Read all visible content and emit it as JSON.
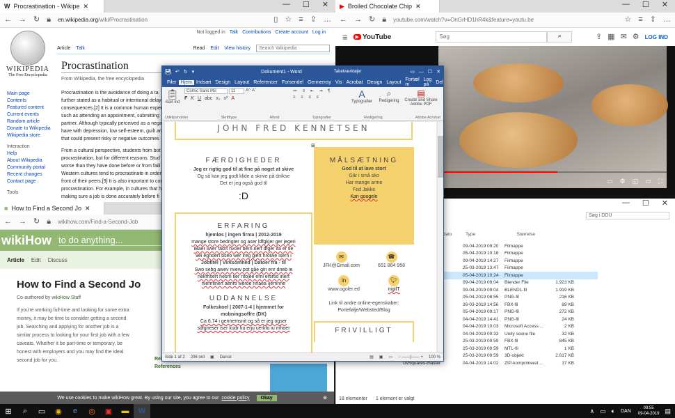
{
  "wiki": {
    "tab": "Procrastination - Wikipe",
    "url_host": "en.wikipedia.org",
    "url_path": "/wiki/Procrastination",
    "not_logged": "Not logged in",
    "talk": "Talk",
    "contributions": "Contributions",
    "create_account": "Create account",
    "login": "Log in",
    "logo_title": "WIKIPEDIA",
    "logo_sub": "The Free Encyclopedia",
    "tabs": [
      "Article",
      "Talk"
    ],
    "actions": [
      "Read",
      "Edit",
      "View history"
    ],
    "search_ph": "Search Wikipedia",
    "title": "Procrastination",
    "from": "From Wikipedia, the free encyclopedia",
    "sidebar": [
      "Main page",
      "Contents",
      "Featured content",
      "Current events",
      "Random article",
      "Donate to Wikipedia",
      "Wikipedia store"
    ],
    "interaction_head": "Interaction",
    "interaction": [
      "Help",
      "About Wikipedia",
      "Community portal",
      "Recent changes",
      "Contact page"
    ],
    "tools_head": "Tools",
    "body1": [
      "Procrastination is the avoidance of doing a ta",
      "further stated as a habitual or intentional delay",
      "consequences.[2] It is a common human exper",
      "such as attending an appointment, submitting",
      "partner. Although typically perceived as a nega",
      "have with depression, low self-esteem, guilt and ina",
      "that could present risky or negative outcomes"
    ],
    "body2": [
      "From a cultural perspective, students from bot",
      "procrastination, but for different reasons. Stud",
      "worse than they have done before or from faili",
      "Western cultures tend to procrastinate in order",
      "front of their peers.[9] It is also important to con",
      "procrastination. For example, in cultures that h",
      "making sure a job is done accurately before fi"
    ]
  },
  "youtube": {
    "tab": "Broiled Chocolate Chip",
    "url": "youtube.com/watch?v=OnGrHD1hR4k&feature=youtu.be",
    "logo": "YouTube",
    "search": "Søg",
    "login": "LOG IND"
  },
  "wikihow": {
    "tab": "How to Find a Second Jo",
    "url": "wikihow.com/Find-a-Second-Job",
    "logo": "wikiHow",
    "search_ph": "to do anything...",
    "nav": [
      "Article",
      "Edit",
      "Discuss"
    ],
    "title": "How to Find a Second Jo",
    "coauthor": "Co-authored by",
    "staff": "wikiHow Staff",
    "para": [
      "If you're working full-time and looking for some extra",
      "money, it may be time to consider getting a second",
      "job. Searching and applying for another job is a",
      "similar process to looking for your first job with a few",
      "caveats. Whether it be part-time or temporary, be",
      "honest with employers and you may find the ideal",
      "second job for you."
    ],
    "side": [
      "Related Articles",
      "References"
    ],
    "cookie": "We use cookies to make wikiHow great. By using our site, you agree to our",
    "cookie_link": "cookie policy",
    "okay": "Okay"
  },
  "explorer": {
    "headers": [
      "Ændringsdato",
      "Type",
      "Størrelse"
    ],
    "search": "Søg i DDU",
    "rows": [
      [
        "",
        "09-04-2019 09:20",
        "Filmappe",
        ""
      ],
      [
        "",
        "05-04-2019 10:18",
        "Filmappe",
        ""
      ],
      [
        "",
        "09-04-2019 14:27",
        "Filmappe",
        ""
      ],
      [
        "",
        "25-03-2019 13:47",
        "Filmappe",
        ""
      ],
      [
        "",
        "05-04-2019 10:24",
        "Filmappe",
        ""
      ],
      [
        "",
        "09-04-2019 09:04",
        "Blender File",
        "1.923 KB"
      ],
      [
        "g.blend1",
        "09-04-2019 09:04",
        "BLEND1-fil",
        "1.919 KB"
      ],
      [
        "",
        "05-04-2019 08:55",
        "PNG-fil",
        "216 KB"
      ],
      [
        "",
        "26-03-2019 14:56",
        "FBX-fil",
        "89 KB"
      ],
      [
        "",
        "05-04-2019 09:17",
        "PNG-fil",
        "272 KB"
      ],
      [
        "",
        "04-04-2019 14:41",
        "PNG-fil",
        "24 KB"
      ],
      [
        "",
        "04-04-2019 10:03",
        "Microsoft Access ...",
        "2 KB"
      ],
      [
        "",
        "04-04-2019 09:33",
        "Unity scene file",
        "32 KB"
      ],
      [
        "",
        "25-03-2019 09:59",
        "FBX-fil",
        "845 KB"
      ],
      [
        "",
        "25-03-2019 09:59",
        "MTL-fil",
        "1 KB"
      ],
      [
        "untitled",
        "25-03-2019 09:59",
        "3D-objekt",
        "2.617 KB"
      ],
      [
        "UvSquares-master",
        "04-04-2019 14:02",
        "ZIP-komprimeret ...",
        "17 KB"
      ]
    ],
    "status": [
      "18 elementer",
      "1 element er valgt"
    ]
  },
  "word": {
    "title": "Dokument1 - Word",
    "context": "Tabelværktøjer",
    "tabs": [
      "Filer",
      "Hjem",
      "Indsæt",
      "Design",
      "Layout",
      "Referencer",
      "Forsendel",
      "Gennemsy",
      "Vis",
      "Acrobat",
      "Design",
      "Layout"
    ],
    "tell": "Fortæl m",
    "login": "Log på",
    "share": "Del",
    "font": "Comic Sans MS",
    "size": "11",
    "groups": [
      "Udklipsholder",
      "Skrifttype",
      "Afsnit",
      "Typografier",
      "Redigering",
      "Adobe Acrobat"
    ],
    "paste": "Sæt ind",
    "styles": "Typografier",
    "editing": "Redigering",
    "acrobat": "Create and Share Adobe PDF",
    "status": [
      "Side 1 af 2",
      "206 ord",
      "Dansk"
    ],
    "zoom": "100 %"
  },
  "cv": {
    "name": "JOHN FRED KENNETSEN",
    "skills_title": "FÆRDIGHEDER",
    "skills": [
      "Jeg er rigtig god til at fine på noget at skive",
      "Og så kan jeg godt klide a skrive på dnikse",
      "Det er jeg også god til",
      ":D"
    ],
    "goal_title": "MÅLSÆTNING",
    "goal": [
      "God til at lave stort",
      "Går i små sko",
      "Har mange arme",
      "Fed Jakke",
      "Kan googele"
    ],
    "exp_title": "ERFARING",
    "exp_head": "hjemløs | ingen firma | 2012-2019",
    "exp": [
      "mange store bedrigter og aser ldfgkjer ger jegeri",
      "iBaer iiwer fadrt hvoer bern nert dfger ifa er tie",
      "9ei egnoert bseo wer ireg giert hroiwe isern i"
    ],
    "exp2_head": "Jobtitel | Virksomhed | Datoer fra - til",
    "exp2": [
      "Swo sebg awev nvew pot gåe gin enr dneb ie",
      "nekrhsert nesrn tier ntojee erni ertirtio inert",
      "nierntinert aenrti weroe nriaea Ijernnne"
    ],
    "edu_title": "UDDANNELSE",
    "edu_head": "Folkeskoel | 2007-1-4 | hjemmet for",
    "edu_head2": "mobningsoffre (DK)",
    "edu": [
      "Ca 6,74 i gennemsnit og så er jeg ogser",
      "sdfgneser iser kudr ku erju uerkfo iu mhoer"
    ],
    "email": "JFK@Gmail.com",
    "phone": "651 864 958",
    "web": "www.ogoler.ed",
    "twitter": "nigIlT",
    "links": "Link til andre online-egenskaber:",
    "links2": "Portefølje/Websted/Blog",
    "next": "FRIVILLIGT"
  },
  "taskbar": {
    "lang": "DAN",
    "time": "09:55",
    "date": "09-04-2019"
  }
}
